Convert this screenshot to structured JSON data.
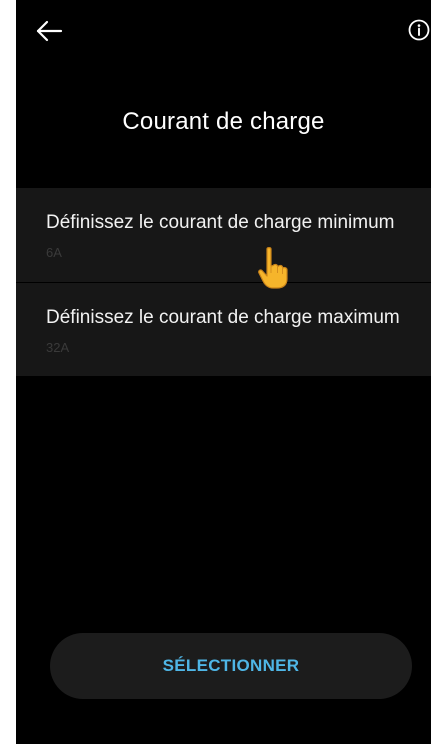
{
  "header": {
    "back_icon": "arrow-left-icon",
    "info_icon": "info-circle-icon",
    "title": "Courant de charge"
  },
  "settings": {
    "items": [
      {
        "label": "Définissez le courant de charge minimum",
        "value": "6A"
      },
      {
        "label": "Définissez le courant de charge maximum",
        "value": "32A"
      }
    ]
  },
  "footer": {
    "select_label": "SÉLECTIONNER"
  },
  "colors": {
    "background": "#000000",
    "card": "#171717",
    "accent": "#4fb6e6",
    "text": "#f2f2f2",
    "muted": "#3a3a3a"
  }
}
